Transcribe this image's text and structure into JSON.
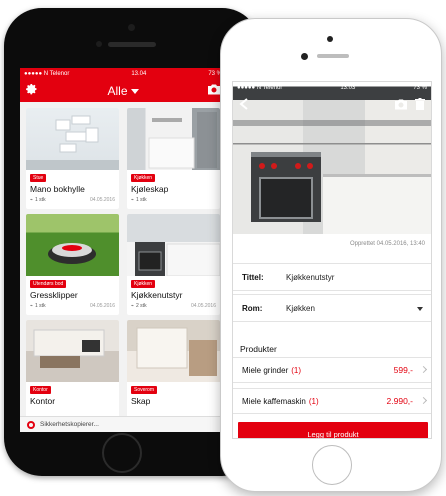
{
  "list_screen": {
    "status": {
      "carrier": "●●●●● N Telenor",
      "time": "13.04",
      "battery": "73 %"
    },
    "nav": {
      "title": "Alle"
    },
    "cards": [
      {
        "tag": "Stue",
        "name": "Mano bokhylle",
        "qty": "1 stk",
        "date": "04.05.2016"
      },
      {
        "tag": "Kjøkken",
        "name": "Kjøleskap",
        "qty": "1 stk",
        "date": ""
      },
      {
        "tag": "Utendørs bod",
        "name": "Gressklipper",
        "qty": "1 stk",
        "date": "04.05.2016"
      },
      {
        "tag": "Kjøkken",
        "name": "Kjøkkenutstyr",
        "qty": "2 stk",
        "date": "04.05.2016"
      },
      {
        "tag": "Kontor",
        "name": "Kontor",
        "qty": "",
        "date": ""
      },
      {
        "tag": "Soverom",
        "name": "Skap",
        "qty": "",
        "date": ""
      }
    ],
    "bottom_status": "Sikkerhetskopierer..."
  },
  "detail_screen": {
    "status": {
      "carrier": "●●●●● N Telenor",
      "time": "13.03",
      "battery": "73 %"
    },
    "created": "Opprettet 04.05.2016, 13:40",
    "title_field": {
      "label": "Tittel:",
      "value": "Kjøkkenutstyr"
    },
    "room_field": {
      "label": "Rom:",
      "value": "Kjøkken"
    },
    "products_heading": "Produkter",
    "products": [
      {
        "name": "Miele grinder",
        "count": "(1)",
        "price": "599,-"
      },
      {
        "name": "Miele kaffemaskin",
        "count": "(1)",
        "price": "2.990,-"
      }
    ],
    "add_button": "Legg til produkt"
  },
  "colors": {
    "accent": "#e3000f",
    "background": "#f2f2f2"
  },
  "icons": [
    "gear-icon",
    "camera-icon",
    "back-chevron-icon",
    "trash-icon",
    "paperclip-icon",
    "spinner-icon",
    "chevron-right-icon",
    "dropdown-caret-icon"
  ]
}
